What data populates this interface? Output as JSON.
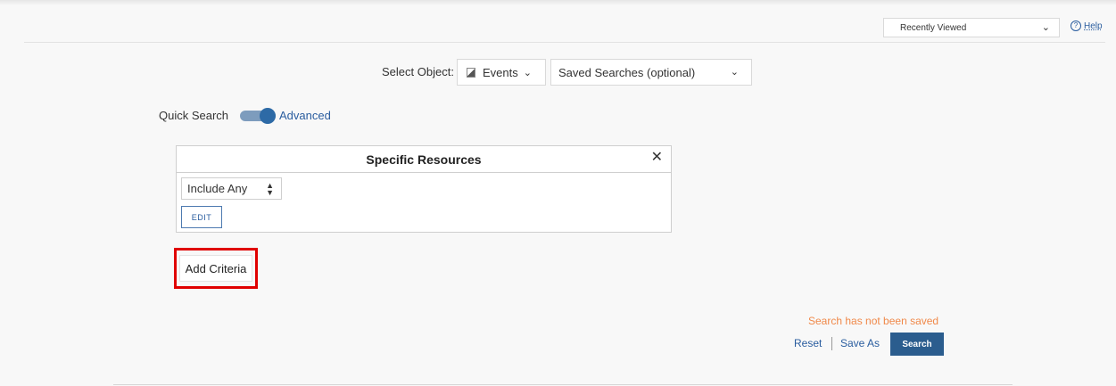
{
  "header": {
    "recent_select_value": "Recently Viewed",
    "help_label": "Help"
  },
  "object_row": {
    "label": "Select Object:",
    "object_value": "Events",
    "saved_search_value": "Saved Searches (optional)"
  },
  "mode": {
    "quick_label": "Quick Search",
    "advanced_label": "Advanced",
    "advanced_enabled": true
  },
  "panel": {
    "title": "Specific Resources",
    "include_value": "Include Any",
    "edit_label": "EDIT"
  },
  "add_criteria_label": "Add Criteria",
  "footer": {
    "status": "Search has not been saved",
    "reset_label": "Reset",
    "save_as_label": "Save As",
    "search_label": "Search"
  },
  "colors": {
    "accent": "#2b5d8e",
    "link": "#2a5d9f",
    "warning": "#f0894a",
    "highlight": "#e00000"
  }
}
